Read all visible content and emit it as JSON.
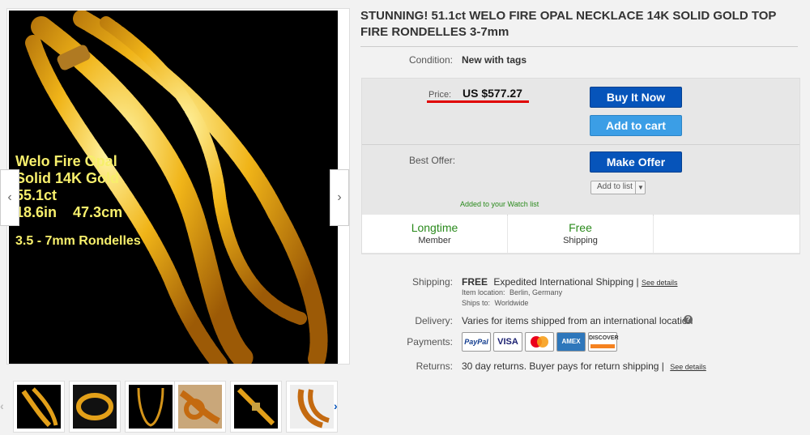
{
  "listing": {
    "title": "STUNNING! 51.1ct WELO FIRE OPAL NECKLACE 14K SOLID GOLD TOP FIRE RONDELLES 3-7mm"
  },
  "image_overlay": {
    "line1": "Welo Fire Opal",
    "line2": "Solid 14K Gold",
    "line3": "55.1ct",
    "line4": "18.6in    47.3cm",
    "line5": "3.5 - 7mm Rondelles"
  },
  "condition": {
    "label": "Condition:",
    "value": "New with tags"
  },
  "price": {
    "label": "Price:",
    "value": "US $577.27"
  },
  "buttons": {
    "buy_now": "Buy It Now",
    "add_to_cart": "Add to cart",
    "make_offer": "Make Offer",
    "add_to_list": "Add to list"
  },
  "best_offer": {
    "label": "Best Offer:"
  },
  "watch": {
    "text": "Added to your Watch list"
  },
  "features": [
    {
      "title": "Longtime",
      "subtitle": "Member"
    },
    {
      "title": "Free",
      "subtitle": "Shipping"
    }
  ],
  "shipping": {
    "label": "Shipping:",
    "free": "FREE",
    "method": "Expedited International Shipping |",
    "see_details": "See details",
    "location_label": "Item location:",
    "location_value": "Berlin, Germany",
    "ships_to_label": "Ships to:",
    "ships_to_value": "Worldwide"
  },
  "delivery": {
    "label": "Delivery:",
    "value": "Varies for items shipped from an international location"
  },
  "payments": {
    "label": "Payments:",
    "cards": [
      "PayPal",
      "VISA",
      "MasterCard",
      "AMEX",
      "DISCOVER"
    ]
  },
  "returns": {
    "label": "Returns:",
    "value": "30 day returns. Buyer pays for return shipping |",
    "see_details": "See details"
  },
  "colors": {
    "accent_blue": "#0654ba",
    "light_blue": "#3b9ee6",
    "feature_green": "#2a8a1c",
    "price_underline": "#e00000"
  }
}
